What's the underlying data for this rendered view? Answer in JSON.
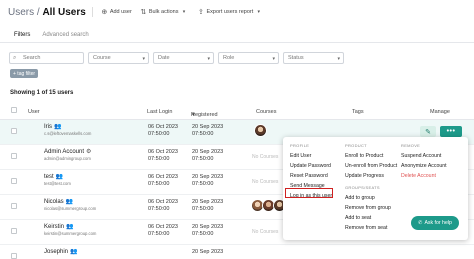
{
  "header": {
    "breadcrumb": "Users /",
    "current": "All Users",
    "add_user": "Add user",
    "bulk_actions": "Bulk actions",
    "export": "Export users report"
  },
  "tabs": [
    "Filters",
    "Advanced search"
  ],
  "filters": {
    "search_placeholder": "Search",
    "course": "Course",
    "date": "Date",
    "role": "Role",
    "status": "Status",
    "tag_filter": "+ tag filter"
  },
  "showing": "Showing 1 of 15 users",
  "columns": {
    "user": "User",
    "last_login": "Last Login",
    "registered": "Registered",
    "courses": "Courses",
    "tags": "Tags",
    "manage": "Manage"
  },
  "rows": [
    {
      "name": "Iris",
      "email": "c.s@leftovemaskells.com",
      "last_login": [
        "06 Oct 2023",
        "07:50:00"
      ],
      "registered": [
        "20 Sep 2023",
        "07:50:00"
      ],
      "courses": "avatar"
    },
    {
      "name": "Admin Account",
      "email": "admin@admingroup.com",
      "last_login": [
        "06 Oct 2023",
        "07:50:00"
      ],
      "registered": [
        "20 Sep 2023",
        "07:50:00"
      ],
      "courses": "No Courses"
    },
    {
      "name": "test",
      "email": "test@test.com",
      "last_login": [
        "06 Oct 2023",
        "07:50:00"
      ],
      "registered": [
        "20 Sep 2023",
        "07:50:00"
      ],
      "courses": "No Courses"
    },
    {
      "name": "Nicolas",
      "email": "nicolas@summergroup.com",
      "last_login": [
        "06 Oct 2023",
        "07:50:00"
      ],
      "registered": [
        "20 Sep 2023",
        "07:50:00"
      ],
      "courses": "avatars"
    },
    {
      "name": "Keirstin",
      "email": "keirstin@summergroup.com",
      "last_login": [
        "06 Oct 2023",
        "07:50:00"
      ],
      "registered": [
        "20 Sep 2023",
        "07:50:00"
      ],
      "courses": "No Courses"
    },
    {
      "name": "Josephin",
      "email": "",
      "last_login": [
        "",
        ""
      ],
      "registered": [
        "20 Sep 2023",
        ""
      ],
      "courses": ""
    }
  ],
  "menu": {
    "profile": {
      "header": "PROFILE",
      "items": [
        "Edit User",
        "Update Password",
        "Reset Password",
        "Send Message",
        "Log in as this user"
      ]
    },
    "product": {
      "header": "PRODUCT",
      "items": [
        "Enroll to Product",
        "Un-enroll from Product",
        "Update Progress"
      ]
    },
    "groups": {
      "header": "GROUPS/SEATS",
      "items": [
        "Add to group",
        "Remove from group",
        "Add to seat",
        "Remove from seat"
      ]
    },
    "remove": {
      "header": "REMOVE",
      "items": [
        "Suspend Account",
        "Anonymize Account",
        "Delete Account"
      ]
    }
  },
  "help": "Ask for help",
  "colors": {
    "accent": "#1d9a8a",
    "danger": "#e05252",
    "highlight": "#d02020"
  }
}
